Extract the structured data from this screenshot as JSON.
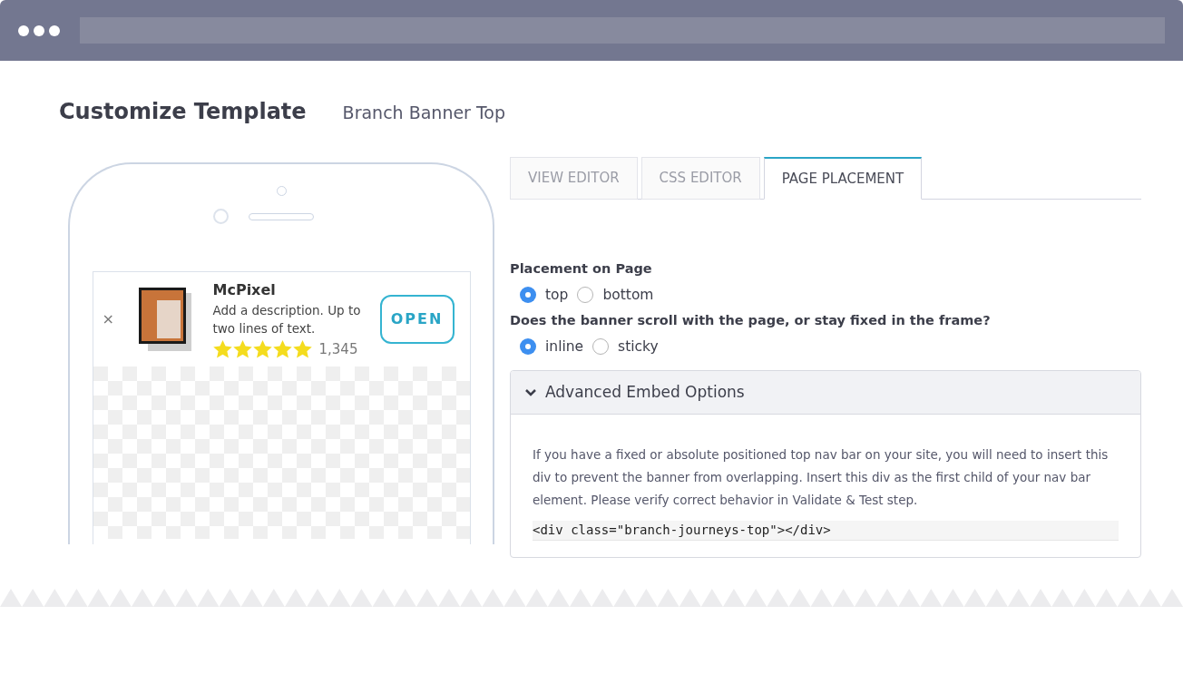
{
  "page": {
    "title": "Customize Template",
    "subtitle": "Branch Banner Top"
  },
  "banner": {
    "close": "×",
    "app_name": "McPixel",
    "description": "Add a description. Up to two lines of text.",
    "stars": 5,
    "rating_count": "1,345",
    "button": "OPEN"
  },
  "tabs": [
    {
      "label": "VIEW EDITOR",
      "selected": false
    },
    {
      "label": "CSS EDITOR",
      "selected": false
    },
    {
      "label": "PAGE PLACEMENT",
      "selected": true
    }
  ],
  "radio_groups": [
    {
      "label": "Placement on Page",
      "options": [
        {
          "label": "top",
          "selected": true
        },
        {
          "label": "bottom",
          "selected": false
        }
      ]
    },
    {
      "label": "Does the banner scroll with the page, or stay fixed in the frame?",
      "options": [
        {
          "label": "inline",
          "selected": true
        },
        {
          "label": "sticky",
          "selected": false
        }
      ]
    }
  ],
  "advanced": {
    "title": "Advanced Embed Options",
    "expanded": true,
    "text": "If you have a fixed or absolute positioned top nav bar on your site, you will need to insert this div to prevent the banner from overlapping. Insert this div as the first child of your nav bar element. Please verify correct behavior in Validate & Test step.",
    "code": "<div class=\"branch-journeys-top\"></div>"
  }
}
